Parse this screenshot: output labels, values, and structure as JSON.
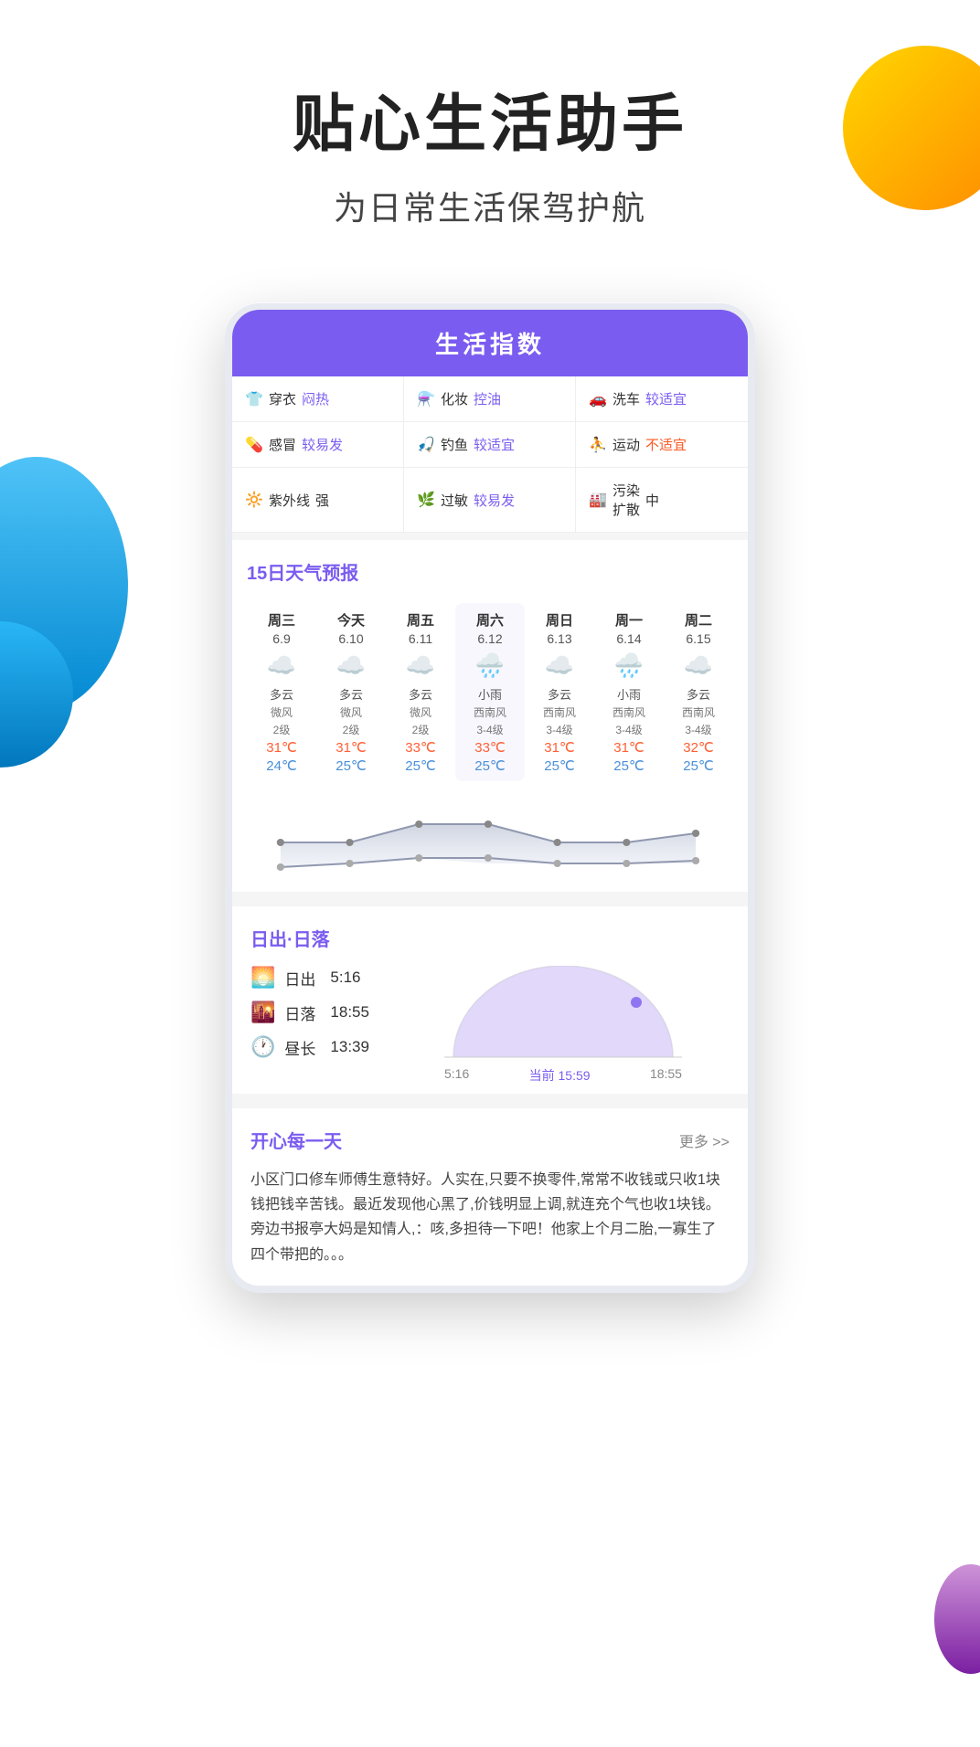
{
  "hero": {
    "title": "贴心生活助手",
    "subtitle": "为日常生活保驾护航"
  },
  "lifeIndex": {
    "header": "生活指数",
    "items": [
      {
        "icon": "👕",
        "name": "穿衣",
        "value": "闷热",
        "valueColor": "purple"
      },
      {
        "icon": "💄",
        "name": "化妆",
        "value": "控油",
        "valueColor": "purple"
      },
      {
        "icon": "🚗",
        "name": "洗车",
        "value": "较适宜",
        "valueColor": "purple"
      },
      {
        "icon": "💊",
        "name": "感冒",
        "value": "较易发",
        "valueColor": "purple"
      },
      {
        "icon": "🎣",
        "name": "钓鱼",
        "value": "较适宜",
        "valueColor": "purple"
      },
      {
        "icon": "🏀",
        "name": "运动",
        "value": "不适宜",
        "valueColor": "red"
      },
      {
        "icon": "☀️",
        "name": "紫外线",
        "value": "强",
        "valueColor": "normal"
      },
      {
        "icon": "🌿",
        "name": "过敏",
        "value": "较易发",
        "valueColor": "purple"
      },
      {
        "icon": "🏭",
        "name": "污染扩散",
        "value": "中",
        "valueColor": "normal"
      }
    ]
  },
  "forecast": {
    "title": "15日天气预报",
    "days": [
      {
        "name": "周三",
        "date": "6.9",
        "icon": "☁️",
        "weather": "多云",
        "wind": "微风",
        "level": "2级",
        "high": "31℃",
        "low": "24℃"
      },
      {
        "name": "今天",
        "date": "6.10",
        "icon": "☁️",
        "weather": "多云",
        "wind": "微风",
        "level": "2级",
        "high": "31℃",
        "low": "25℃"
      },
      {
        "name": "周五",
        "date": "6.11",
        "icon": "☁️",
        "weather": "多云",
        "wind": "微风",
        "level": "2级",
        "high": "33℃",
        "low": "25℃"
      },
      {
        "name": "周六",
        "date": "6.12",
        "icon": "🌧️",
        "weather": "小雨",
        "wind": "西南风",
        "level": "3-4级",
        "high": "33℃",
        "low": "25℃"
      },
      {
        "name": "周日",
        "date": "6.13",
        "icon": "☁️",
        "weather": "多云",
        "wind": "西南风",
        "level": "3-4级",
        "high": "31℃",
        "low": "25℃"
      },
      {
        "name": "周一",
        "date": "6.14",
        "icon": "🌧️",
        "weather": "小雨",
        "wind": "西南风",
        "level": "3-4级",
        "high": "31℃",
        "low": "25℃"
      },
      {
        "name": "周二",
        "date": "6.15",
        "icon": "☁️",
        "weather": "多云",
        "wind": "西南风",
        "level": "3-4级",
        "high": "32℃",
        "low": "25℃"
      }
    ]
  },
  "sunInfo": {
    "title": "日出·日落",
    "sunrise_label": "日出",
    "sunrise_time": "5:16",
    "sunset_label": "日落",
    "sunset_time": "18:55",
    "duration_label": "昼长",
    "duration_time": "13:39",
    "chart_start": "5:16",
    "chart_current": "当前 15:59",
    "chart_end": "18:55"
  },
  "happySection": {
    "title": "开心每一天",
    "more": "更多 >>",
    "text": "小区门口修车师傅生意特好。人实在,只要不换零件,常常不收钱或只收1块钱把钱辛苦钱。最近发现他心黑了,价钱明显上调,就连充个气也收1块钱。旁边书报亭大妈是知情人,：咳,多担待一下吧！他家上个月二胎,一寡生了四个带把的。。。"
  },
  "colors": {
    "purple": "#7B5CF0",
    "orange": "#FF8C00",
    "blue": "#0288D1",
    "red": "#FF5722",
    "tempHigh": "#FF6035",
    "tempLow": "#4A90D9"
  }
}
